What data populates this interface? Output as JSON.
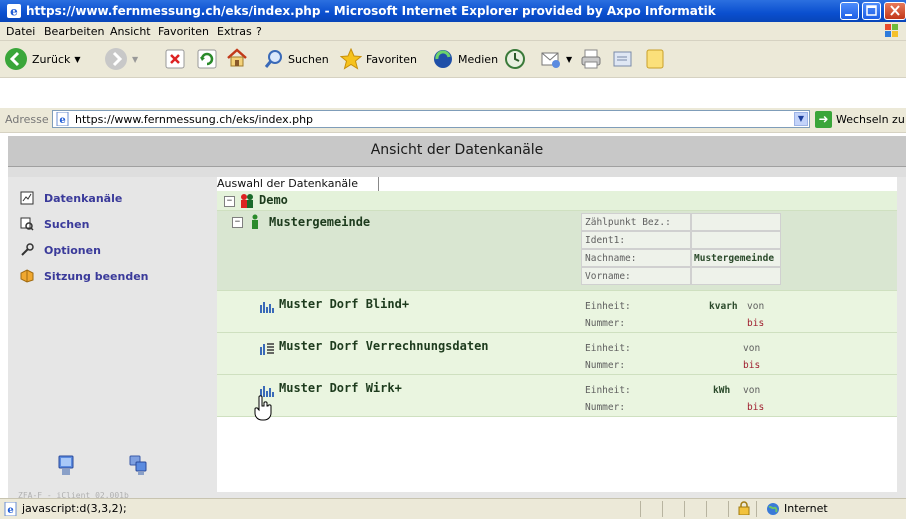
{
  "window": {
    "title": "https://www.fernmessung.ch/eks/index.php - Microsoft Internet Explorer provided by Axpo Informatik"
  },
  "menu": [
    "Datei",
    "Bearbeiten",
    "Ansicht",
    "Favoriten",
    "Extras",
    "?"
  ],
  "toolbar": {
    "back_label": "Zurück",
    "search_label": "Suchen",
    "favorites_label": "Favoriten",
    "media_label": "Medien"
  },
  "address": {
    "label": "Adresse",
    "url": "https://www.fernmessung.ch/eks/index.php",
    "go_label": "Wechseln zu"
  },
  "page": {
    "header": "Ansicht der Datenkanäle",
    "version": "ZFA-F - iClient 02.001b"
  },
  "nav": {
    "items": [
      {
        "label": "Datenkanäle",
        "icon": "chart-icon"
      },
      {
        "label": "Suchen",
        "icon": "search-icon"
      },
      {
        "label": "Optionen",
        "icon": "wrench-icon"
      },
      {
        "label": "Sitzung beenden",
        "icon": "logout-icon"
      }
    ]
  },
  "main": {
    "breadcrumb": "Auswahl der Datenkanäle",
    "demo": {
      "toggle": "−",
      "title": "Demo"
    },
    "muster": {
      "toggle": "−",
      "title": "Mustergemeinde",
      "fields": [
        {
          "label": "Zählpunkt Bez.:",
          "value": ""
        },
        {
          "label": "Ident1:",
          "value": ""
        },
        {
          "label": "Nachname:",
          "value": "Mustergemeinde"
        },
        {
          "label": "Vorname:",
          "value": ""
        }
      ]
    },
    "channels": [
      {
        "title": "Muster Dorf Blind+",
        "einheit_label": "Einheit:",
        "einheit": "kvarh",
        "von": "von",
        "nummer_label": "Nummer:",
        "bis": "bis"
      },
      {
        "title": "Muster Dorf Verrechnungsdaten",
        "einheit_label": "Einheit:",
        "einheit": "",
        "von": "von",
        "nummer_label": "Nummer:",
        "bis": "bis"
      },
      {
        "title": "Muster Dorf Wirk+",
        "einheit_label": "Einheit:",
        "einheit": "kWh",
        "von": "von",
        "nummer_label": "Nummer:",
        "bis": "bis"
      }
    ]
  },
  "status": {
    "text": "javascript:d(3,3,2);",
    "zone": "Internet"
  }
}
